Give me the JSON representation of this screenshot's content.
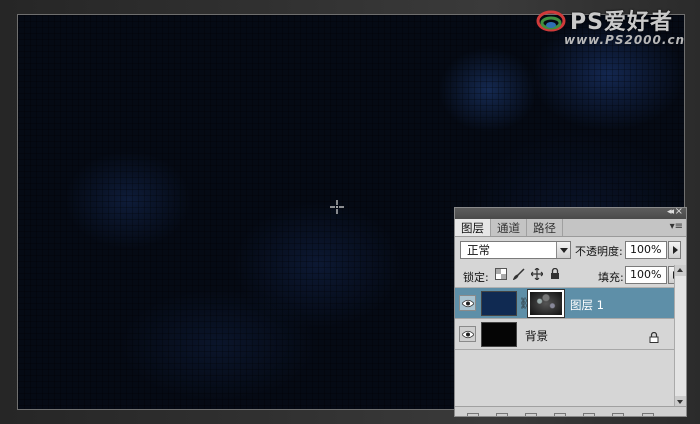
{
  "watermark": {
    "brand": "PS爱好者",
    "url": "www.PS2000.cn",
    "mark_icon": "ps-logo-mark"
  },
  "canvas": {
    "cursor_icon": "crosshair-cursor-icon",
    "background_color": "#050a14",
    "cloud_color": "#1a3466"
  },
  "layers_panel": {
    "tabs": [
      {
        "label": "图层",
        "active": true
      },
      {
        "label": "通道",
        "active": false
      },
      {
        "label": "路径",
        "active": false
      }
    ],
    "blend_mode": "正常",
    "opacity_label": "不透明度:",
    "opacity_value": "100%",
    "lock_label": "锁定:",
    "fill_label": "填充:",
    "fill_value": "100%",
    "lock_icons": [
      "lock-transparent-icon",
      "lock-brush-icon",
      "lock-move-icon",
      "lock-all-icon"
    ],
    "layers": [
      {
        "name": "图层 1",
        "selected": true,
        "visible": true,
        "thumb_color": "#102a52",
        "has_mask": true
      },
      {
        "name": "背景",
        "selected": false,
        "visible": true,
        "thumb_color": "#050505",
        "locked": true
      }
    ],
    "selection_color": "#5e8fa8"
  }
}
